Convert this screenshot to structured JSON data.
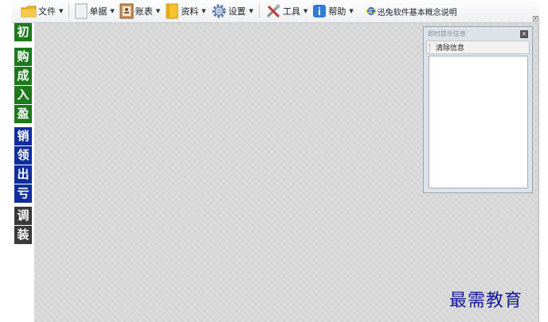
{
  "toolbar": {
    "items": [
      {
        "label": "文件",
        "icon": "folder-icon"
      },
      {
        "label": "单据",
        "icon": "document-icon"
      },
      {
        "label": "账表",
        "icon": "ledger-icon"
      },
      {
        "label": "资料",
        "icon": "binder-icon"
      },
      {
        "label": "设置",
        "icon": "gear-icon"
      },
      {
        "label": "工具",
        "icon": "tools-icon"
      },
      {
        "label": "帮助",
        "icon": "info-icon"
      }
    ],
    "help_link": "迅兔软件基本概念说明",
    "caret": "▼"
  },
  "leftnav": {
    "groups": [
      {
        "color": "#1c7a1c",
        "items": [
          "初"
        ]
      },
      {
        "color": "#1c7a1c",
        "items": [
          "购",
          "成",
          "入",
          "盈"
        ]
      },
      {
        "color": "#0f2d9b",
        "items": [
          "销",
          "领",
          "出",
          "亏"
        ]
      },
      {
        "color": "#3a3a3a",
        "items": [
          "调",
          "装"
        ]
      }
    ]
  },
  "panel": {
    "title": "即时提示信息",
    "close": "×",
    "clear_button": "清除信息"
  },
  "watermark": "最需教育"
}
